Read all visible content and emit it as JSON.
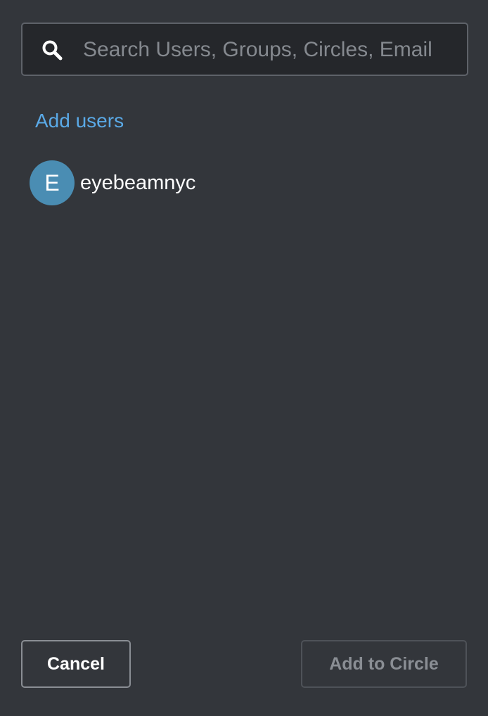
{
  "search": {
    "placeholder": "Search Users, Groups, Circles, Email"
  },
  "add_users_link": "Add users",
  "users": [
    {
      "initial": "E",
      "name": "eyebeamnyc",
      "avatar_color": "#4a8db3"
    }
  ],
  "footer": {
    "cancel_label": "Cancel",
    "submit_label": "Add to Circle",
    "submit_disabled": true
  },
  "colors": {
    "background": "#33363b",
    "input_background": "#25272b",
    "link": "#5aa9e6",
    "disabled_text": "#8a8e94"
  }
}
